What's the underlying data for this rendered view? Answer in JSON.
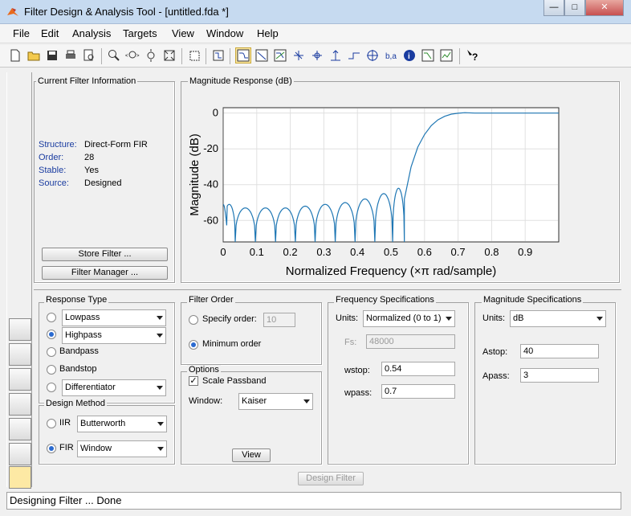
{
  "window": {
    "title": "Filter Design & Analysis Tool -  [untitled.fda *]",
    "controls": [
      "—",
      "□",
      "✕"
    ]
  },
  "menu": [
    "File",
    "Edit",
    "Analysis",
    "Targets",
    "View",
    "Window",
    "Help"
  ],
  "toolbar_icons": [
    "new-icon",
    "open-icon",
    "save-icon",
    "print-icon",
    "print-preview-icon",
    "zoom-in-icon",
    "zoom-x-icon",
    "zoom-y-icon",
    "full-view-icon",
    "new-figure-icon",
    "filter-specs-icon",
    "magnitude-response-icon",
    "phase-response-icon",
    "magnitude-phase-icon",
    "group-delay-icon",
    "phase-delay-icon",
    "impulse-response-icon",
    "step-response-icon",
    "pole-zero-icon",
    "filter-coefficients-icon",
    "filter-info-icon",
    "magnitude-estimate-icon",
    "round-off-noise-icon",
    "whats-this-icon"
  ],
  "current_filter": {
    "title": "Current Filter Information",
    "rows": [
      {
        "key": "Structure:",
        "value": "Direct-Form FIR"
      },
      {
        "key": "Order:",
        "value": "28"
      },
      {
        "key": "Stable:",
        "value": "Yes"
      },
      {
        "key": "Source:",
        "value": "Designed"
      }
    ],
    "store_button": "Store Filter ...",
    "manager_button": "Filter Manager ..."
  },
  "plot": {
    "panel_title": "Magnitude Response (dB)",
    "colors": {
      "line": "#1f77b4",
      "grid": "#e0e0e0"
    }
  },
  "chart_data": {
    "type": "line",
    "xlabel": "Normalized Frequency (×π rad/sample)",
    "ylabel": "Magnitude (dB)",
    "xlim": [
      0,
      1
    ],
    "ylim": [
      -72,
      3
    ],
    "xticks": [
      "0",
      "0.1",
      "0.2",
      "0.3",
      "0.4",
      "0.5",
      "0.6",
      "0.7",
      "0.8",
      "0.9"
    ],
    "xtick_values": [
      0,
      0.1,
      0.2,
      0.3,
      0.4,
      0.5,
      0.6,
      0.7,
      0.8,
      0.9
    ],
    "yticks": [
      "0",
      "-20",
      "-40",
      "-60"
    ],
    "ytick_values": [
      0,
      -20,
      -40,
      -60
    ],
    "grid": true,
    "series": [
      {
        "stopband_lobe_nulls": [
          0.0,
          0.036,
          0.096,
          0.156,
          0.215,
          0.274,
          0.334,
          0.393,
          0.452,
          0.505,
          0.54
        ],
        "stopband_lobe_peaks": [
          -51,
          -53,
          -53,
          -53,
          -52,
          -51,
          -50,
          -48,
          -45,
          -42
        ],
        "transition_x": [
          0.54,
          0.56,
          0.58,
          0.6,
          0.62,
          0.64,
          0.66,
          0.68,
          0.7,
          0.72,
          0.75,
          1.0
        ],
        "transition_y": [
          -48,
          -30,
          -19,
          -12,
          -7,
          -3.8,
          -1.8,
          -0.6,
          -0.1,
          0.2,
          0,
          0
        ]
      }
    ]
  },
  "response_type": {
    "title": "Response Type",
    "options": [
      "Lowpass",
      "Highpass",
      "Bandpass",
      "Bandstop",
      "Differentiator"
    ],
    "lowpass_combo": "Lowpass",
    "highpass_combo": "Highpass",
    "differentiator_combo": "Differentiator"
  },
  "design_method": {
    "title": "Design Method",
    "iir_label": "IIR",
    "iir_value": "Butterworth",
    "fir_label": "FIR",
    "fir_value": "Window"
  },
  "filter_order": {
    "title": "Filter Order",
    "specify_label": "Specify order:",
    "specify_value": "10",
    "minimum_label": "Minimum order"
  },
  "options": {
    "title": "Options",
    "scale_passband": "Scale Passband",
    "window_label": "Window:",
    "window_value": "Kaiser",
    "view_button": "View"
  },
  "frequency_specs": {
    "title": "Frequency Specifications",
    "units_label": "Units:",
    "units_value": "Normalized (0 to 1)",
    "fs_label": "Fs:",
    "fs_value": "48000",
    "wstop_label": "wstop:",
    "wstop_value": "0.54",
    "wpass_label": "wpass:",
    "wpass_value": "0.7"
  },
  "magnitude_specs": {
    "title": "Magnitude Specifications",
    "units_label": "Units:",
    "units_value": "dB",
    "astop_label": "Astop:",
    "astop_value": "40",
    "apass_label": "Apass:",
    "apass_value": "3"
  },
  "design_button": "Design Filter",
  "status": "Designing Filter ... Done"
}
